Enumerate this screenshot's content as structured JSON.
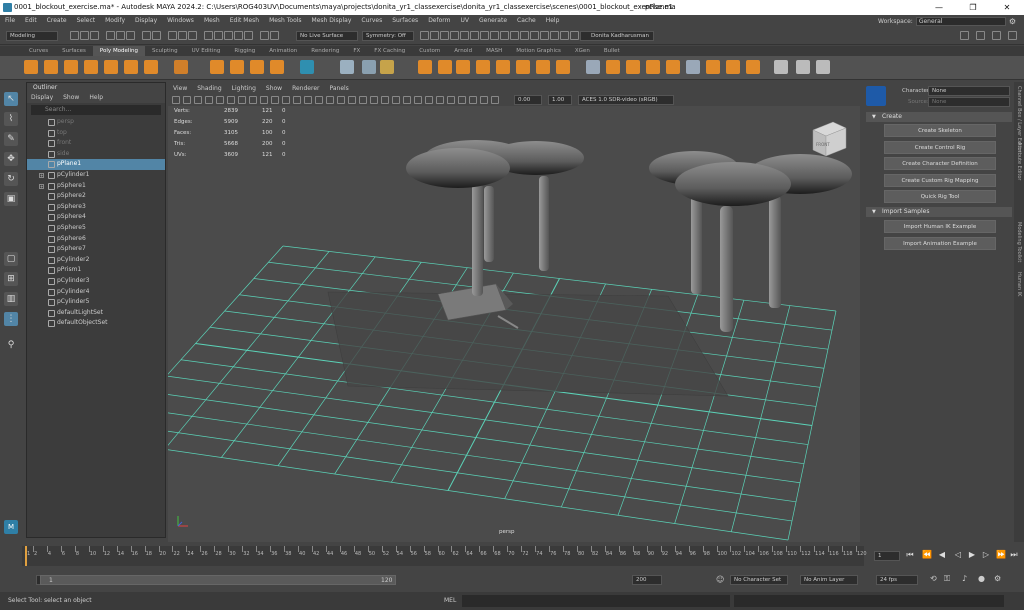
{
  "window": {
    "title": "0001_blockout_exercise.ma* - Autodesk MAYA 2024.2: C:\\Users\\ROG403UV\\Documents\\maya\\projects\\donita_yr1_classexercise\\donita_yr1_classexercise\\scenes\\0001_blockout_exercise.ma",
    "selected_node": "pPlane1",
    "controls": [
      "—",
      "❐",
      "✕"
    ]
  },
  "menubar": [
    "File",
    "Edit",
    "Create",
    "Select",
    "Modify",
    "Display",
    "Windows",
    "Mesh",
    "Edit Mesh",
    "Mesh Tools",
    "Mesh Display",
    "Curves",
    "Surfaces",
    "Deform",
    "UV",
    "Generate",
    "Cache",
    "Help"
  ],
  "workspace": {
    "label": "Workspace:",
    "value": "General"
  },
  "statusline": {
    "menuset": "Modeling",
    "live_surface": "No Live Surface",
    "symmetry": "Symmetry: Off",
    "user": "Donita Kadharusman"
  },
  "shelf_tabs": [
    "Curves",
    "Surfaces",
    "Poly Modeling",
    "Sculpting",
    "UV Editing",
    "Rigging",
    "Animation",
    "Rendering",
    "FX",
    "FX Caching",
    "Custom",
    "Arnold",
    "MASH",
    "Motion Graphics",
    "XGen",
    "Bullet"
  ],
  "shelf_active": "Poly Modeling",
  "outliner": {
    "title": "Outliner",
    "menu": [
      "Display",
      "Show",
      "Help"
    ],
    "search_placeholder": "Search...",
    "items": [
      {
        "name": "persp",
        "dim": true
      },
      {
        "name": "top",
        "dim": true
      },
      {
        "name": "front",
        "dim": true
      },
      {
        "name": "side",
        "dim": true
      },
      {
        "name": "pPlane1",
        "selected": true
      },
      {
        "name": "pCylinder1",
        "expand": true
      },
      {
        "name": "pSphere1",
        "expand": true
      },
      {
        "name": "pSphere2"
      },
      {
        "name": "pSphere3"
      },
      {
        "name": "pSphere4"
      },
      {
        "name": "pSphere5"
      },
      {
        "name": "pSphere6"
      },
      {
        "name": "pSphere7"
      },
      {
        "name": "pCylinder2"
      },
      {
        "name": "pPrism1"
      },
      {
        "name": "pCylinder3"
      },
      {
        "name": "pCylinder4"
      },
      {
        "name": "pCylinder5"
      },
      {
        "name": "defaultLightSet"
      },
      {
        "name": "defaultObjectSet"
      }
    ]
  },
  "viewport": {
    "menu": [
      "View",
      "Shading",
      "Lighting",
      "Show",
      "Renderer",
      "Panels"
    ],
    "exposure": "0.00",
    "gamma": "1.00",
    "colorspace": "ACES 1.0 SDR-video (sRGB)",
    "camera": "persp",
    "viewcube_label": "FRONT",
    "hud": [
      {
        "label": "Verts:",
        "a": "2839",
        "b": "121",
        "c": "0"
      },
      {
        "label": "Edges:",
        "a": "5909",
        "b": "220",
        "c": "0"
      },
      {
        "label": "Faces:",
        "a": "3105",
        "b": "100",
        "c": "0"
      },
      {
        "label": "Tris:",
        "a": "5668",
        "b": "200",
        "c": "0"
      },
      {
        "label": "UVs:",
        "a": "3609",
        "b": "121",
        "c": "0"
      }
    ]
  },
  "humanik": {
    "character_label": "Character:",
    "character_value": "None",
    "source_label": "Source:",
    "source_value": "None",
    "create_section": "Create",
    "create_buttons": [
      "Create Skeleton",
      "Create Control Rig",
      "Create Character Definition",
      "Create Custom Rig Mapping",
      "Quick Rig Tool"
    ],
    "import_section": "Import Samples",
    "import_buttons": [
      "Import Human IK Example",
      "Import Animation Example"
    ]
  },
  "side_tabs": [
    "Channel Box / Layer Editor",
    "Attribute Editor",
    "Modeling Toolkit",
    "Human IK"
  ],
  "timeslider": {
    "ticks": [
      "1",
      "2",
      "4",
      "6",
      "8",
      "10",
      "12",
      "14",
      "16",
      "18",
      "20",
      "22",
      "24",
      "26",
      "28",
      "30",
      "32",
      "34",
      "36",
      "38",
      "40",
      "42",
      "44",
      "46",
      "48",
      "50",
      "52",
      "54",
      "56",
      "58",
      "60",
      "62",
      "64",
      "66",
      "68",
      "70",
      "72",
      "74",
      "76",
      "78",
      "80",
      "82",
      "84",
      "86",
      "88",
      "90",
      "92",
      "94",
      "96",
      "98",
      "100",
      "102",
      "104",
      "106",
      "108",
      "110",
      "112",
      "114",
      "116",
      "118",
      "120"
    ],
    "current_frame": "1"
  },
  "range": {
    "start": "1",
    "inner_start": "1",
    "inner_end": "120",
    "end": "200",
    "character_set": "No Character Set",
    "anim_layer": "No Anim Layer",
    "fps": "24 fps"
  },
  "command": {
    "help_text": "Select Tool: select an object",
    "lang": "MEL"
  }
}
